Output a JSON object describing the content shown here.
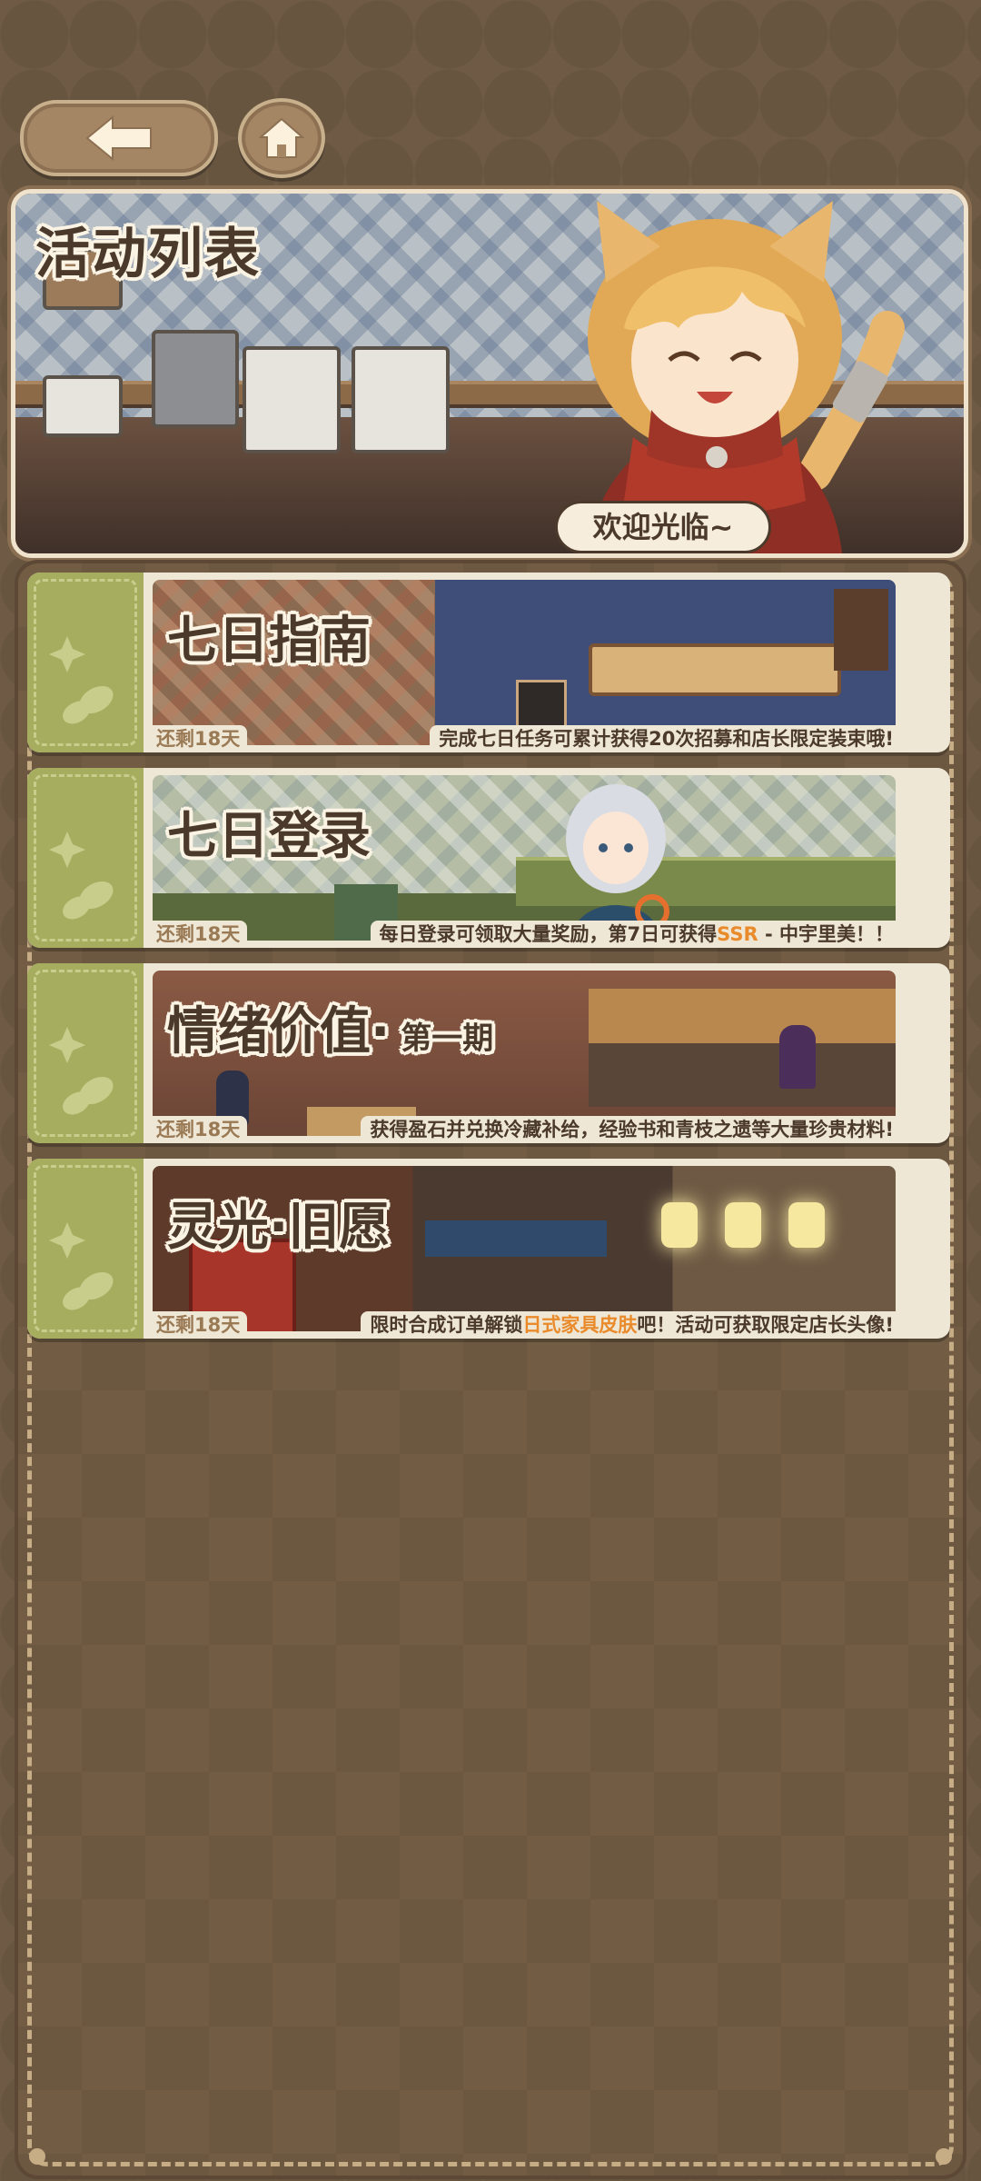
{
  "header": {
    "back_icon": "arrow-left-icon",
    "home_icon": "house-icon"
  },
  "banner": {
    "title": "活动列表",
    "welcome": "欢迎光临~"
  },
  "events": [
    {
      "title": "七日指南",
      "subtitle": "",
      "remaining": "还剩18天",
      "desc_pre": "完成七日任务可累计获得20次招募和店长限定装束哦!",
      "desc_hl": "",
      "desc_post": ""
    },
    {
      "title": "七日登录",
      "subtitle": "",
      "remaining": "还剩18天",
      "desc_pre": "每日登录可领取大量奖励，第7日可获得",
      "desc_hl": "SSR",
      "desc_post": " - 中宇里美！！"
    },
    {
      "title": "情绪价值·",
      "subtitle": "第一期",
      "remaining": "还剩18天",
      "desc_pre": "获得盈石并兑换冷藏补给，经验书和青枝之遗等大量珍贵材料!",
      "desc_hl": "",
      "desc_post": ""
    },
    {
      "title": "灵光·旧愿",
      "subtitle": "",
      "remaining": "还剩18天",
      "desc_pre": "限时合成订单解锁",
      "desc_hl": "日式家具皮肤",
      "desc_post": "吧！活动可获取限定店长头像!"
    }
  ],
  "colors": {
    "background": "#6f5b45",
    "card_tab": "#a7ad5f",
    "card_bg": "#efe7d6",
    "highlight": "#e98a2b",
    "text_dark": "#4b3a2c"
  }
}
